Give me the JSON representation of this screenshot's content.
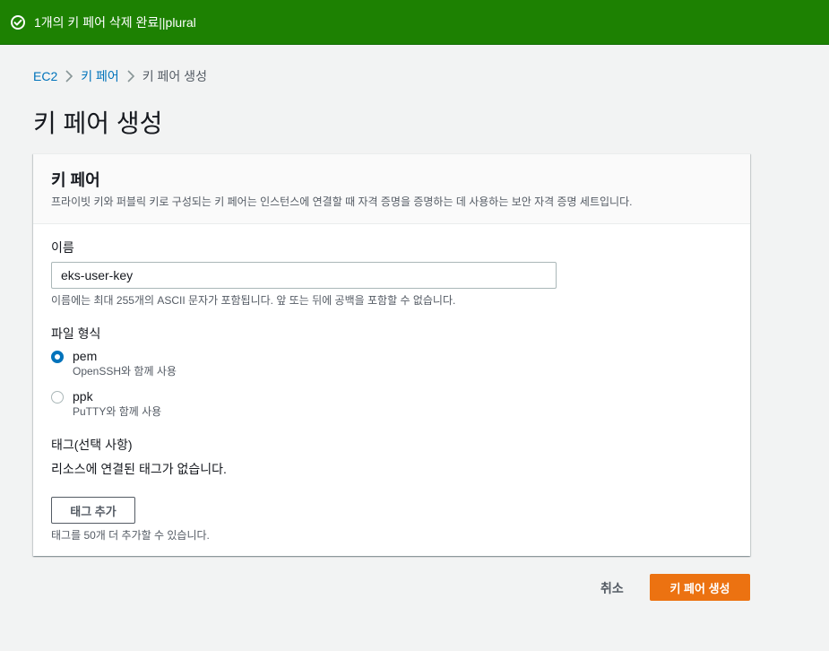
{
  "flash": {
    "icon": "check-circle-icon",
    "message": "1개의 키 페어 삭제 완료||plural",
    "color": "#1d8102"
  },
  "breadcrumb": {
    "items": [
      "EC2",
      "키 페어"
    ],
    "current": "키 페어 생성"
  },
  "page": {
    "title": "키 페어 생성"
  },
  "panel": {
    "title": "키 페어",
    "description": "프라이빗 키와 퍼블릭 키로 구성되는 키 페어는 인스턴스에 연결할 때 자격 증명을 증명하는 데 사용하는 보안 자격 증명 세트입니다."
  },
  "form": {
    "name_label": "이름",
    "name_value": "eks-user-key",
    "name_hint": "이름에는 최대 255개의 ASCII 문자가 포함됩니다. 앞 또는 뒤에 공백을 포함할 수 없습니다.",
    "file_format_label": "파일 형식",
    "formats": [
      {
        "name": "pem",
        "desc": "OpenSSH와 함께 사용",
        "selected": true
      },
      {
        "name": "ppk",
        "desc": "PuTTY와 함께 사용",
        "selected": false
      }
    ],
    "tags_label": "태그(선택 사항)",
    "tags_empty": "리소스에 연결된 태그가 없습니다.",
    "add_tag_button": "태그 추가",
    "tags_hint": "태그를 50개 더 추가할 수 있습니다."
  },
  "footer": {
    "cancel_label": "취소",
    "submit_label": "키 페어 생성",
    "accent_color": "#ec7211"
  }
}
